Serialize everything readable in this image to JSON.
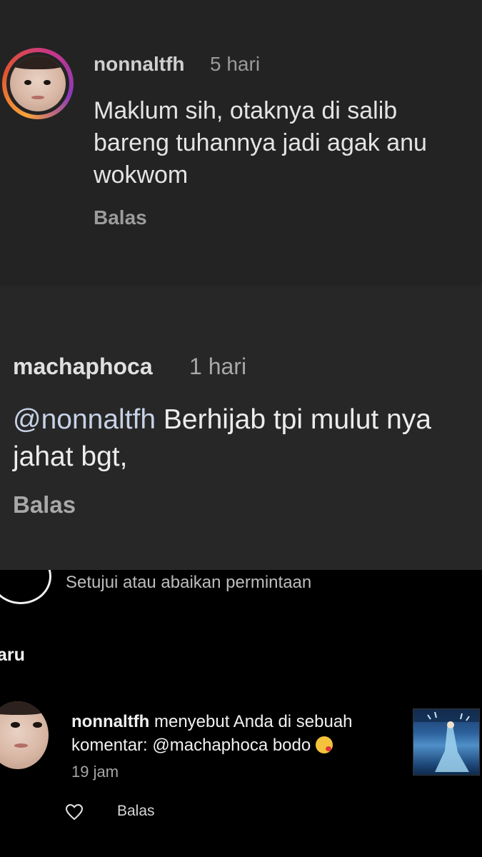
{
  "comment1": {
    "username": "nonnaltfh",
    "time": "5 hari",
    "text": "Maklum sih, otaknya di salib bareng tuhannya jadi agak anu wokwom",
    "reply_label": "Balas"
  },
  "comment2": {
    "username": "machaphoca",
    "time": "1 hari",
    "mention": "@nonnaltfh",
    "text_line1": " Berhijab tpi mulut nya",
    "text_line2": "jahat bgt,",
    "reply_label": "Balas"
  },
  "notifications": {
    "request_text": "Setujui atau abaikan permintaan",
    "section_title": "aru",
    "item": {
      "username": "nonnaltfh",
      "message_part1": " menyebut Anda di sebuah komentar: @machaphoca bodo ",
      "emoji": "kissing-face-emoji",
      "time": "19 jam",
      "reply_label": "Balas"
    }
  }
}
